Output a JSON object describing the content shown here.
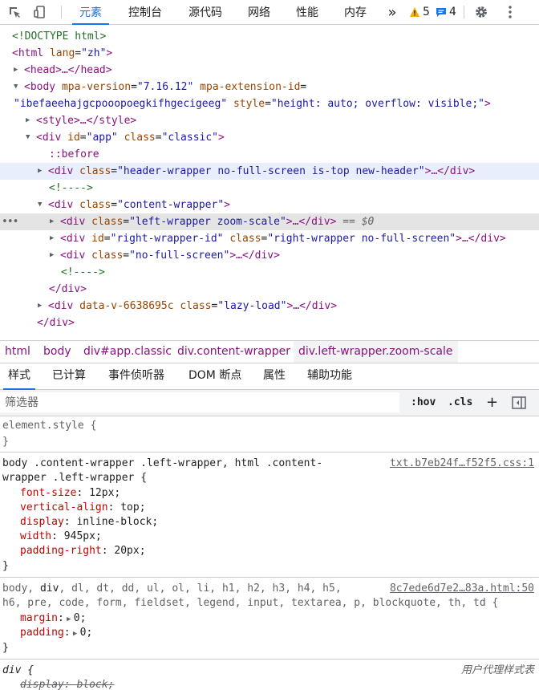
{
  "toolbar": {
    "tabs": [
      "元素",
      "控制台",
      "源代码",
      "网络",
      "性能",
      "内存"
    ],
    "more": "»",
    "warnings_count": "5",
    "messages_count": "4"
  },
  "tree": {
    "l1": "<!DOCTYPE html>",
    "l2_tag": "<html",
    "l2_attr": "lang",
    "l2_val": "\"zh\"",
    "l2_end": ">",
    "l3": "<head>…</head>",
    "l4_tag": "<body",
    "l4_attr1": "mpa-version",
    "l4_val1": "\"7.16.12\"",
    "l4_attr2": "mpa-extension-id",
    "l5_val2": "\"ibefaeehajgcpooopoegkifhgecigeeg\"",
    "l5_attr3": "style",
    "l5_val3": "\"height: auto; overflow: visible;\"",
    "l5_end": ">",
    "l6": "<style>…</style>",
    "l7_tag": "<div",
    "l7_attr1": "id",
    "l7_val1": "\"app\"",
    "l7_attr2": "class",
    "l7_val2": "\"classic\"",
    "l7_end": ">",
    "l8": "::before",
    "l9_tag": "<div",
    "l9_attr": "class",
    "l9_val": "\"header-wrapper no-full-screen is-top new-header\"",
    "l9_end": ">…</div>",
    "l10": "<!---->",
    "l11_tag": "<div",
    "l11_attr": "class",
    "l11_val": "\"content-wrapper\"",
    "l11_end": ">",
    "l12_tag": "<div",
    "l12_attr": "class",
    "l12_val": "\"left-wrapper zoom-scale\"",
    "l12_end": ">…</div>",
    "l12_eq": "== $0",
    "l13_tag": "<div",
    "l13_attr1": "id",
    "l13_val1": "\"right-wrapper-id\"",
    "l13_attr2": "class",
    "l13_val2": "\"right-wrapper no-full-screen\"",
    "l13_end": ">…</div>",
    "l14_tag": "<div",
    "l14_attr": "class",
    "l14_val": "\"no-full-screen\"",
    "l14_end": ">…</div>",
    "l15": "<!---->",
    "l16": "</div>",
    "l17_tag": "<div",
    "l17_attr1": "data-v-6638695c",
    "l17_attr2": "class",
    "l17_val2": "\"lazy-load\"",
    "l17_end": ">…</div>",
    "l18": "</div>"
  },
  "breadcrumbs": [
    "html",
    "body",
    "div#app.classic",
    "div.content-wrapper",
    "div.left-wrapper.zoom-scale"
  ],
  "subtabs": [
    "样式",
    "已计算",
    "事件侦听器",
    "DOM 断点",
    "属性",
    "辅助功能"
  ],
  "filter": {
    "placeholder": "筛选器",
    "hov": ":hov",
    "cls": ".cls",
    "plus": "+"
  },
  "styles": {
    "r1_sel": "element.style {",
    "r1_close": "}",
    "r2_sel1": "body .content-wrapper .left-wrapper, html .content-",
    "r2_sel2": "wrapper .left-wrapper",
    "r2_brace": " {",
    "r2_src": "txt.b7eb24f…f52f5.css:1",
    "r2_props": [
      {
        "name": "font-size",
        "value": "12px;"
      },
      {
        "name": "vertical-align",
        "value": "top;"
      },
      {
        "name": "display",
        "value": "inline-block;"
      },
      {
        "name": "width",
        "value": "945px;"
      },
      {
        "name": "padding-right",
        "value": "20px;"
      }
    ],
    "r2_close": "}",
    "r3_sel1a": "body, ",
    "r3_sel1b": "div",
    "r3_sel1c": ", dl, dt, dd, ul, ol, li, h1, h2, h3, h4, h5,",
    "r3_sel2": "h6, pre, code, form, fieldset, legend, input, textarea, p, blockquote, th, td {",
    "r3_src": "8c7ede6d7e2…83a.html:50",
    "r3_p1_name": "margin",
    "r3_p1_val": "0;",
    "r3_p2_name": "padding",
    "r3_p2_val": "0;",
    "r3_close": "}",
    "r4_sel": "div {",
    "r4_src": "用户代理样式表",
    "r4_p1": "display: block;"
  }
}
